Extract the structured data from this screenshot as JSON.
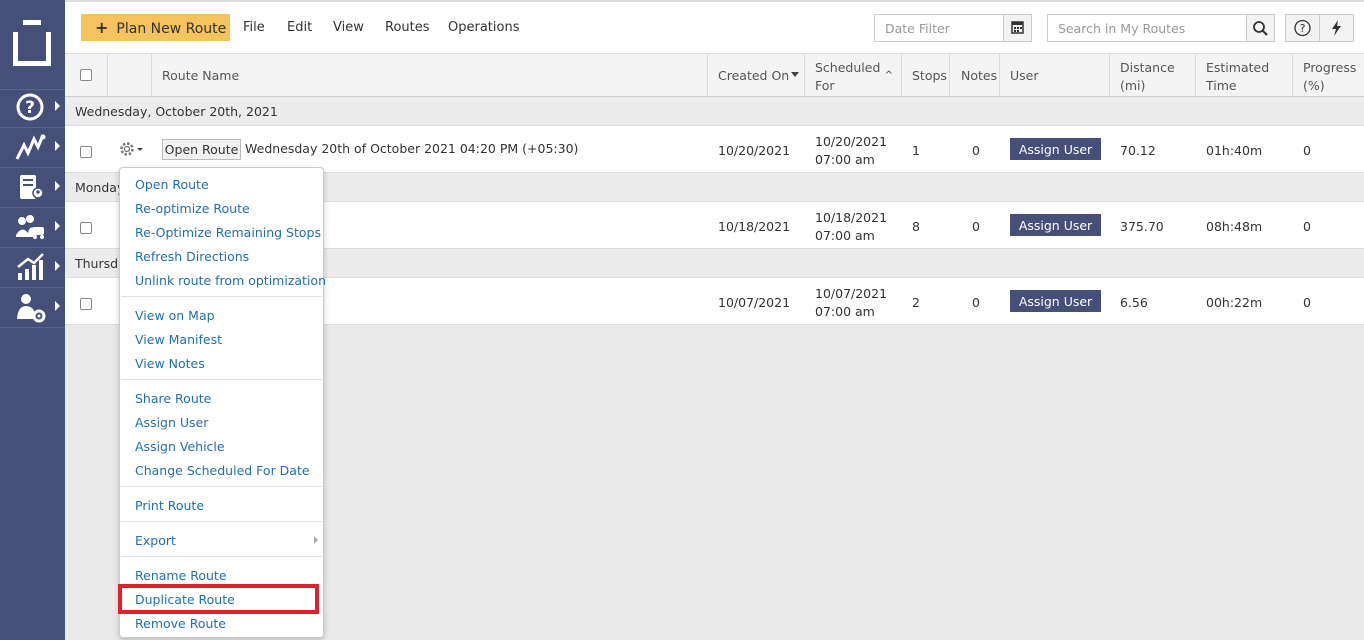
{
  "toolbar": {
    "plan_label": "Plan New Route",
    "menus": [
      "File",
      "Edit",
      "View",
      "Routes",
      "Operations"
    ],
    "date_filter_placeholder": "Date Filter",
    "search_placeholder": "Search in My Routes"
  },
  "sidebar": {
    "items": [
      "help-icon",
      "routes-icon",
      "addressbook-icon",
      "fleet-icon",
      "analytics-icon",
      "user-settings-icon"
    ]
  },
  "columns": {
    "route_name": "Route Name",
    "created_on": "Created On",
    "scheduled_for_1": "Scheduled",
    "scheduled_for_2": "For",
    "stops": "Stops",
    "notes": "Notes",
    "user": "User",
    "distance_1": "Distance",
    "distance_2": "(mi)",
    "est_time_1": "Estimated",
    "est_time_2": "Time",
    "progress_1": "Progress",
    "progress_2": "(%)"
  },
  "groups": [
    "Wednesday, October 20th, 2021",
    "Monday",
    "Thursda"
  ],
  "rows": [
    {
      "open_label": "Open Route",
      "name": "Wednesday 20th of October 2021 04:20 PM (+05:30)",
      "created": "10/20/2021",
      "sched_date": "10/20/2021",
      "sched_time": "07:00 am",
      "stops": "1",
      "notes": "0",
      "assign": "Assign User",
      "distance": "70.12",
      "time": "01h:40m",
      "progress": "0"
    },
    {
      "created": "10/18/2021",
      "sched_date": "10/18/2021",
      "sched_time": "07:00 am",
      "stops": "8",
      "notes": "0",
      "assign": "Assign User",
      "distance": "375.70",
      "time": "08h:48m",
      "progress": "0"
    },
    {
      "created": "10/07/2021",
      "sched_date": "10/07/2021",
      "sched_time": "07:00 am",
      "stops": "2",
      "notes": "0",
      "assign": "Assign User",
      "distance": "6.56",
      "time": "00h:22m",
      "progress": "0"
    }
  ],
  "menu": {
    "open_route": "Open Route",
    "reoptimize": "Re-optimize Route",
    "reoptimize_remaining": "Re-Optimize Remaining Stops",
    "refresh": "Refresh Directions",
    "unlink": "Unlink route from optimization",
    "view_map": "View on Map",
    "view_manifest": "View Manifest",
    "view_notes": "View Notes",
    "share": "Share Route",
    "assign_user": "Assign User",
    "assign_vehicle": "Assign Vehicle",
    "change_date": "Change Scheduled For Date",
    "print": "Print Route",
    "export": "Export",
    "rename": "Rename Route",
    "duplicate": "Duplicate Route",
    "remove": "Remove Route"
  },
  "colors": {
    "sidebar": "#454f78",
    "accent": "#f6c25d",
    "link": "#1f6fb5",
    "highlight": "#e0202a"
  }
}
